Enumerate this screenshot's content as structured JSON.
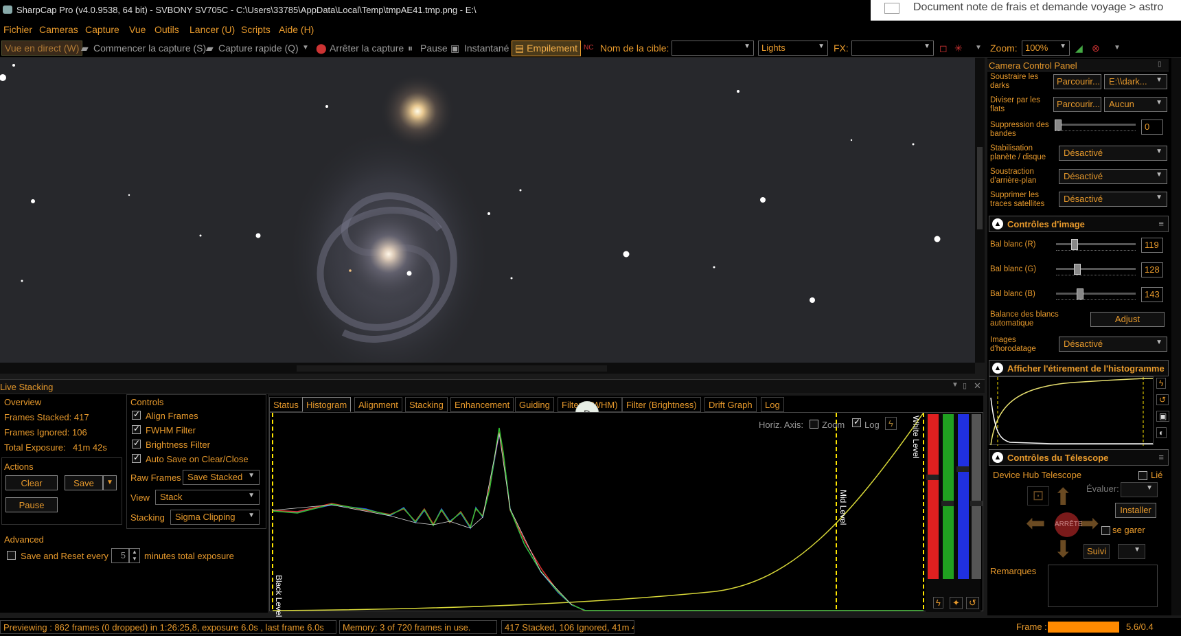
{
  "window": {
    "title": "SharpCap Pro (v4.0.9538, 64 bit) - SVBONY SV705C - C:\\Users\\33785\\AppData\\Local\\Temp\\tmpAE41.tmp.png - E:\\",
    "overlay_doc": "Document note de frais et demande voyage > astro"
  },
  "menu": [
    "Fichier",
    "Cameras",
    "Capture",
    "Vue",
    "Outils",
    "Lancer (U)",
    "Scripts",
    "Aide (H)"
  ],
  "toolbar": {
    "live": "Vue en direct (W)",
    "start": "Commencer la capture (S)",
    "quick": "Capture rapide (Q)",
    "stop": "Arrêter la capture",
    "pause": "Pause",
    "snapshot": "Instantané",
    "stacking": "Empilement",
    "target_label": "Nom de la cible:",
    "target_value": "",
    "frame_type": "Lights",
    "fx_label": "FX:",
    "fx_value": "",
    "zoom_label": "Zoom:",
    "zoom_value": "100%"
  },
  "live_stacking": {
    "title": "Live Stacking",
    "overview": {
      "heading": "Overview",
      "frames_stacked": "Frames Stacked: 417",
      "frames_ignored": "Frames Ignored: 106",
      "total_exposure_label": "Total Exposure:",
      "total_exposure_value": "41m 42s"
    },
    "actions": {
      "heading": "Actions",
      "clear": "Clear",
      "save": "Save",
      "pause": "Pause"
    },
    "controls": {
      "heading": "Controls",
      "align": "Align Frames",
      "fwhm": "FWHM Filter",
      "brightness": "Brightness Filter",
      "autosave": "Auto Save on Clear/Close",
      "raw_label": "Raw Frames",
      "raw_value": "Save Stacked",
      "view_label": "View",
      "view_value": "Stack",
      "stacking_label": "Stacking",
      "stacking_value": "Sigma Clipping"
    },
    "advanced": {
      "heading": "Advanced",
      "reset_label": "Save and Reset every",
      "reset_value": "5",
      "reset_suffix": "minutes total exposure"
    },
    "tabs": [
      "Status",
      "Histogram",
      "Alignment",
      "Stacking",
      "Enhancement",
      "Guiding",
      "Filter (FWHM)",
      "Filter (Brightness)",
      "Drift Graph",
      "Log"
    ],
    "selected_tab": "Histogram",
    "histogram": {
      "horiz_axis": "Horiz. Axis:",
      "zoom": "Zoom",
      "log": "Log",
      "black_level": "Black Level",
      "mid_level": "Mid Level",
      "white_level": "White Level"
    },
    "hover_badge": "D"
  },
  "status": {
    "preview": "Previewing : 862 frames (0 dropped) in 1:26:25,8, exposure 6.0s , last frame 6.0s",
    "memory": "Memory: 3 of 720 frames in use.",
    "stack": "417 Stacked, 106 Ignored, 41m 4",
    "frame_label": "Frame :",
    "frame_value": "5.6/0.4"
  },
  "camera_panel": {
    "title": "Camera Control Panel",
    "darks_label": "Soustraire les darks",
    "darks_browse": "Parcourir...",
    "darks_value": "E:\\\\dark...",
    "flats_label": "Diviser par les flats",
    "flats_browse": "Parcourir...",
    "flats_value": "Aucun",
    "banding_label": "Suppression des bandes",
    "banding_value": "0",
    "stab_label": "Stabilisation planète / disque",
    "stab_value": "Désactivé",
    "bg_label": "Soustraction d'arrière-plan",
    "bg_value": "Désactivé",
    "sat_label": "Supprimer les traces satellites",
    "sat_value": "Désactivé",
    "image_controls": "Contrôles d'image",
    "wb_r_label": "Bal blanc (R)",
    "wb_r": "119",
    "wb_g_label": "Bal blanc (G)",
    "wb_g": "128",
    "wb_b_label": "Bal blanc (B)",
    "wb_b": "143",
    "auto_wb_label": "Balance des blancs automatique",
    "adjust": "Adjust",
    "timestamp_label": "Images d'horodatage",
    "timestamp_value": "Désactivé",
    "stretch_title": "Afficher l'étirement de l'histogramme",
    "telescope_title": "Contrôles du Télescope",
    "telescope_device": "Device Hub Telescope",
    "linked": "Lié",
    "evaluate": "Évaluer:",
    "install": "Installer",
    "park": "se garer",
    "track": "Suivi",
    "stop": "ARRÊTE",
    "remarks": "Remarques"
  }
}
